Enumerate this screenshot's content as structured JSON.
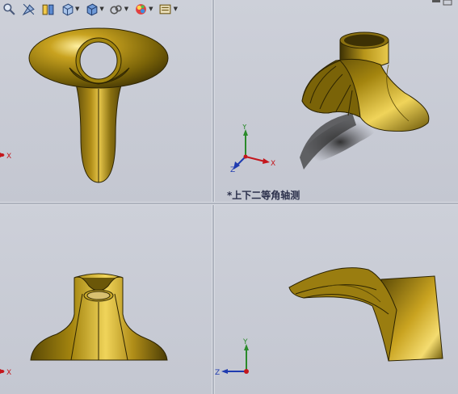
{
  "viewports": {
    "top_left": {
      "label": ""
    },
    "top_right": {
      "label": "*上下二等角轴测"
    },
    "bottom_left": {
      "label": ""
    },
    "bottom_right": {
      "label": ""
    }
  },
  "axes": {
    "x": "X",
    "y": "Y",
    "z": "Z"
  },
  "toolbar": {
    "icons": [
      "zoom-icon",
      "section-view-icon",
      "view-orientation-icon",
      "display-style-icon",
      "hide-show-icon",
      "appearance-icon",
      "scene-icon"
    ]
  },
  "colors": {
    "model": "#8a7210",
    "background": "#c9ccd6",
    "x_axis": "#c4161c",
    "y_axis": "#2a8a2a",
    "z_axis": "#1f3bb0"
  }
}
